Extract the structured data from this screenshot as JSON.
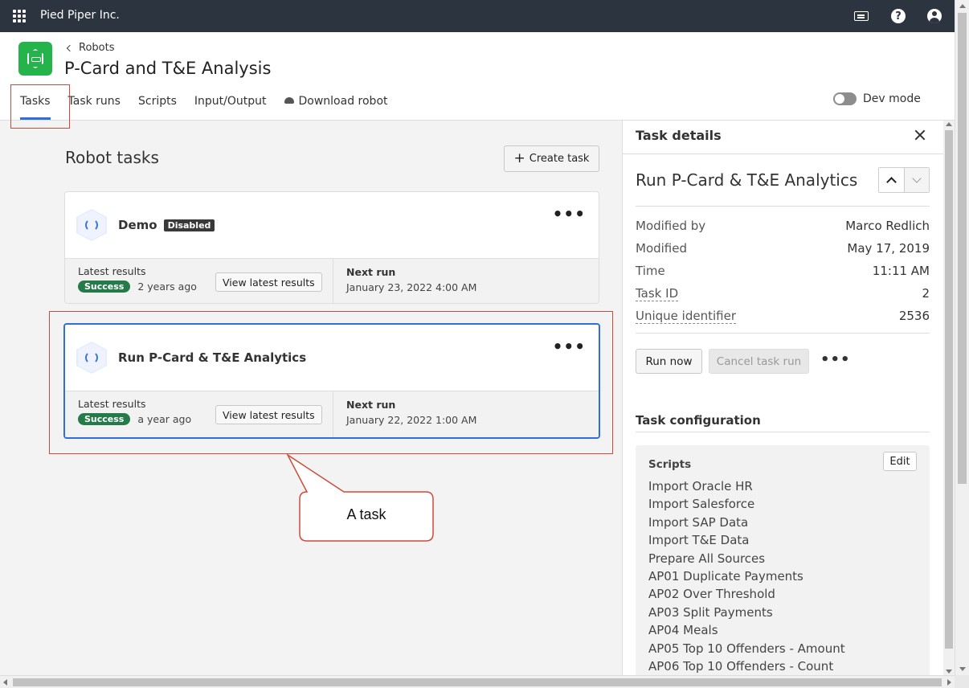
{
  "topbar": {
    "org_name": "Pied Piper Inc.",
    "icons": [
      "apps-grid-icon",
      "keyboard-icon",
      "help-icon",
      "user-icon"
    ]
  },
  "header": {
    "breadcrumb": "Robots",
    "title": "P-Card and T&E Analysis",
    "tabs": [
      {
        "label": "Tasks",
        "active": true
      },
      {
        "label": "Task runs"
      },
      {
        "label": "Scripts"
      },
      {
        "label": "Input/Output"
      },
      {
        "label": "Download robot"
      }
    ],
    "dev_mode_label": "Dev mode"
  },
  "main": {
    "section_title": "Robot tasks",
    "create_task_label": "Create task",
    "tasks": [
      {
        "name": "Demo",
        "badge": "Disabled",
        "latest_results_label": "Latest results",
        "status": "Success",
        "age": "2 years ago",
        "view_label": "View latest results",
        "next_run_label": "Next run",
        "next_run": "January 23, 2022 4:00 AM"
      },
      {
        "name": "Run P-Card & T&E Analytics",
        "latest_results_label": "Latest results",
        "status": "Success",
        "age": "a year ago",
        "view_label": "View latest results",
        "next_run_label": "Next run",
        "next_run": "January 22, 2022 1:00 AM"
      }
    ],
    "callout_text": "A task"
  },
  "panel": {
    "title": "Task details",
    "task_name": "Run P-Card & T&E Analytics",
    "meta": [
      {
        "key": "Modified by",
        "value": "Marco Redlich"
      },
      {
        "key": "Modified",
        "value": "May 17, 2019"
      },
      {
        "key": "Time",
        "value": "11:11 AM"
      },
      {
        "key": "Task ID",
        "value": "2"
      },
      {
        "key": "Unique identifier",
        "value": "2536"
      }
    ],
    "run_now_label": "Run now",
    "cancel_label": "Cancel task run",
    "config_title": "Task configuration",
    "scripts_label": "Scripts",
    "edit_label": "Edit",
    "scripts": [
      "Import Oracle HR",
      "Import Salesforce",
      "Import SAP Data",
      "Import T&E Data",
      "Prepare All Sources",
      "AP01 Duplicate Payments",
      "AP02 Over Threshold",
      "AP03 Split Payments",
      "AP04 Meals",
      "AP05 Top 10 Offenders - Amount",
      "AP06 Top 10 Offenders - Count"
    ]
  },
  "colors": {
    "accent": "#2f6fdb",
    "success": "#257a4a",
    "annotation": "#cf4a3a",
    "topbar": "#2c3440",
    "logo": "#25b34b"
  }
}
